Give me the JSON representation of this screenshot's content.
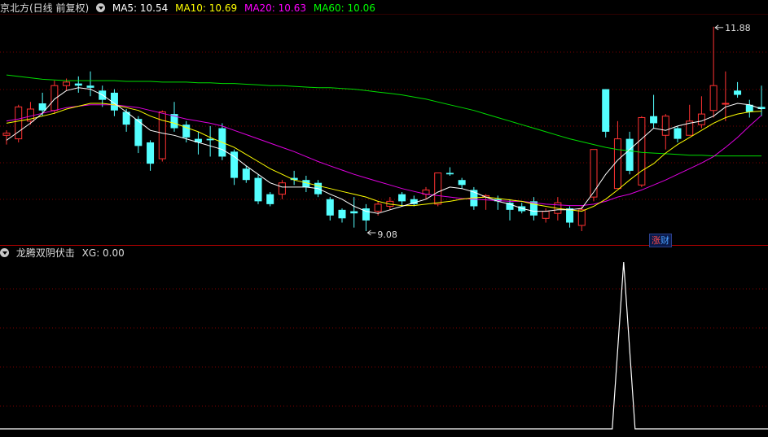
{
  "main_panel": {
    "title": "京北方(日线 前复权)",
    "ma": [
      {
        "label": "MA5: 10.54",
        "color": "#ffffff"
      },
      {
        "label": "MA10: 10.69",
        "color": "#ffff00"
      },
      {
        "label": "MA20: 10.63",
        "color": "#ff00ff"
      },
      {
        "label": "MA60: 10.06",
        "color": "#00ff00"
      }
    ],
    "high_marker": "11.88",
    "low_marker": "9.08",
    "badge": {
      "char1": "涨",
      "char2": "财"
    }
  },
  "indicator_panel": {
    "title": "龙腾双阴伏击",
    "value_label": "XG: 0.00"
  },
  "colors": {
    "up": "#ff3232",
    "down": "#54ffff",
    "grid": "#7a0000",
    "border": "#b00000"
  },
  "chart_data": {
    "type": "candlestick",
    "price_range": [
      9.0,
      12.05
    ],
    "candles": [
      [
        10.35,
        10.38,
        10.22,
        10.42
      ],
      [
        10.3,
        10.75,
        10.25,
        10.78
      ],
      [
        10.55,
        10.72,
        10.5,
        10.82
      ],
      [
        10.8,
        10.7,
        10.62,
        10.95
      ],
      [
        10.7,
        11.05,
        10.65,
        11.12
      ],
      [
        11.05,
        11.1,
        10.98,
        11.15
      ],
      [
        11.08,
        11.05,
        10.95,
        11.18
      ],
      [
        11.05,
        11.02,
        10.9,
        11.25
      ],
      [
        10.98,
        10.85,
        10.75,
        11.05
      ],
      [
        10.95,
        10.7,
        10.62,
        11.0
      ],
      [
        10.68,
        10.5,
        10.4,
        10.72
      ],
      [
        10.58,
        10.2,
        10.1,
        10.62
      ],
      [
        10.25,
        9.95,
        9.85,
        10.28
      ],
      [
        10.02,
        10.68,
        9.98,
        10.7
      ],
      [
        10.65,
        10.45,
        10.4,
        10.82
      ],
      [
        10.5,
        10.32,
        10.25,
        10.55
      ],
      [
        10.3,
        10.25,
        10.08,
        10.4
      ],
      [
        10.3,
        10.28,
        10.05,
        10.48
      ],
      [
        10.45,
        10.05,
        10.0,
        10.52
      ],
      [
        10.12,
        9.75,
        9.65,
        10.15
      ],
      [
        9.88,
        9.72,
        9.68,
        9.92
      ],
      [
        9.75,
        9.42,
        9.38,
        9.8
      ],
      [
        9.52,
        9.38,
        9.35,
        9.55
      ],
      [
        9.52,
        9.68,
        9.45,
        9.72
      ],
      [
        9.75,
        9.72,
        9.65,
        9.85
      ],
      [
        9.72,
        9.62,
        9.55,
        9.78
      ],
      [
        9.68,
        9.52,
        9.48,
        9.72
      ],
      [
        9.45,
        9.22,
        9.15,
        9.48
      ],
      [
        9.3,
        9.18,
        9.12,
        9.32
      ],
      [
        9.28,
        9.25,
        9.05,
        9.48
      ],
      [
        9.32,
        9.15,
        9.0,
        9.38
      ],
      [
        9.28,
        9.38,
        9.22,
        9.42
      ],
      [
        9.35,
        9.42,
        9.3,
        9.48
      ],
      [
        9.52,
        9.42,
        9.36,
        9.55
      ],
      [
        9.45,
        9.38,
        9.35,
        9.5
      ],
      [
        9.52,
        9.58,
        9.45,
        9.62
      ],
      [
        9.38,
        9.82,
        9.35,
        9.82
      ],
      [
        9.82,
        9.8,
        9.78,
        9.9
      ],
      [
        9.72,
        9.65,
        9.6,
        9.75
      ],
      [
        9.58,
        9.35,
        9.3,
        9.62
      ],
      [
        9.48,
        9.5,
        9.3,
        9.52
      ],
      [
        9.45,
        9.42,
        9.3,
        9.5
      ],
      [
        9.4,
        9.3,
        9.15,
        9.45
      ],
      [
        9.35,
        9.28,
        9.25,
        9.4
      ],
      [
        9.42,
        9.22,
        9.15,
        9.48
      ],
      [
        9.18,
        9.28,
        9.12,
        9.32
      ],
      [
        9.25,
        9.4,
        9.15,
        9.48
      ],
      [
        9.32,
        9.12,
        9.05,
        9.35
      ],
      [
        9.08,
        9.3,
        9.0,
        9.35
      ],
      [
        9.48,
        10.15,
        9.42,
        10.15
      ],
      [
        11.0,
        10.4,
        10.32,
        11.0
      ],
      [
        9.6,
        10.3,
        9.6,
        10.55
      ],
      [
        10.3,
        9.85,
        9.8,
        10.4
      ],
      [
        9.65,
        10.6,
        9.62,
        10.62
      ],
      [
        10.62,
        10.52,
        10.45,
        10.92
      ],
      [
        10.35,
        10.62,
        10.15,
        10.65
      ],
      [
        10.45,
        10.3,
        10.25,
        10.48
      ],
      [
        10.35,
        10.55,
        10.35,
        10.78
      ],
      [
        10.5,
        10.65,
        10.45,
        10.9
      ],
      [
        10.7,
        11.05,
        10.6,
        11.88
      ],
      [
        10.8,
        10.8,
        10.55,
        11.25
      ],
      [
        10.98,
        10.92,
        10.88,
        11.1
      ],
      [
        10.78,
        10.68,
        10.6,
        10.85
      ],
      [
        10.75,
        10.72,
        10.62,
        11.05
      ]
    ],
    "MA5": [
      10.28,
      10.4,
      10.52,
      10.66,
      10.86,
      10.98,
      11.02,
      11.0,
      10.92,
      10.8,
      10.68,
      10.55,
      10.42,
      10.38,
      10.35,
      10.3,
      10.25,
      10.2,
      10.15,
      10.05,
      9.92,
      9.8,
      9.68,
      9.62,
      9.62,
      9.62,
      9.6,
      9.52,
      9.45,
      9.35,
      9.28,
      9.25,
      9.3,
      9.35,
      9.4,
      9.45,
      9.55,
      9.62,
      9.6,
      9.55,
      9.48,
      9.42,
      9.38,
      9.32,
      9.28,
      9.28,
      9.3,
      9.3,
      9.32,
      9.55,
      9.8,
      10.0,
      10.15,
      10.3,
      10.45,
      10.42,
      10.48,
      10.52,
      10.55,
      10.62,
      10.75,
      10.8,
      10.78,
      10.72
    ],
    "MA10": [
      10.52,
      10.55,
      10.58,
      10.62,
      10.66,
      10.72,
      10.76,
      10.8,
      10.8,
      10.78,
      10.74,
      10.7,
      10.62,
      10.56,
      10.52,
      10.46,
      10.4,
      10.32,
      10.25,
      10.18,
      10.08,
      9.98,
      9.88,
      9.8,
      9.72,
      9.68,
      9.64,
      9.6,
      9.56,
      9.52,
      9.48,
      9.42,
      9.38,
      9.36,
      9.36,
      9.38,
      9.4,
      9.42,
      9.45,
      9.47,
      9.48,
      9.46,
      9.44,
      9.42,
      9.38,
      9.35,
      9.32,
      9.3,
      9.28,
      9.35,
      9.45,
      9.58,
      9.72,
      9.85,
      9.95,
      10.1,
      10.22,
      10.32,
      10.42,
      10.52,
      10.6,
      10.65,
      10.68,
      10.69
    ],
    "MA20": [
      10.55,
      10.58,
      10.62,
      10.66,
      10.7,
      10.74,
      10.76,
      10.78,
      10.78,
      10.78,
      10.76,
      10.74,
      10.7,
      10.66,
      10.62,
      10.58,
      10.55,
      10.52,
      10.48,
      10.42,
      10.36,
      10.3,
      10.24,
      10.18,
      10.12,
      10.05,
      9.98,
      9.92,
      9.86,
      9.8,
      9.75,
      9.7,
      9.65,
      9.6,
      9.56,
      9.52,
      9.5,
      9.48,
      9.46,
      9.45,
      9.44,
      9.43,
      9.42,
      9.42,
      9.4,
      9.38,
      9.37,
      9.36,
      9.36,
      9.38,
      9.42,
      9.48,
      9.52,
      9.58,
      9.65,
      9.72,
      9.8,
      9.88,
      9.96,
      10.05,
      10.18,
      10.32,
      10.48,
      10.63
    ],
    "MA60": [
      11.2,
      11.18,
      11.16,
      11.14,
      11.13,
      11.12,
      11.12,
      11.12,
      11.12,
      11.12,
      11.11,
      11.11,
      11.11,
      11.1,
      11.1,
      11.1,
      11.09,
      11.09,
      11.08,
      11.08,
      11.07,
      11.06,
      11.05,
      11.05,
      11.04,
      11.03,
      11.02,
      11.02,
      11.01,
      11.0,
      10.98,
      10.96,
      10.94,
      10.92,
      10.89,
      10.86,
      10.82,
      10.78,
      10.74,
      10.7,
      10.65,
      10.6,
      10.55,
      10.5,
      10.45,
      10.4,
      10.35,
      10.3,
      10.26,
      10.22,
      10.18,
      10.15,
      10.13,
      10.11,
      10.1,
      10.09,
      10.08,
      10.07,
      10.07,
      10.06,
      10.06,
      10.06,
      10.06,
      10.06
    ],
    "xg_signal_index": 51
  }
}
